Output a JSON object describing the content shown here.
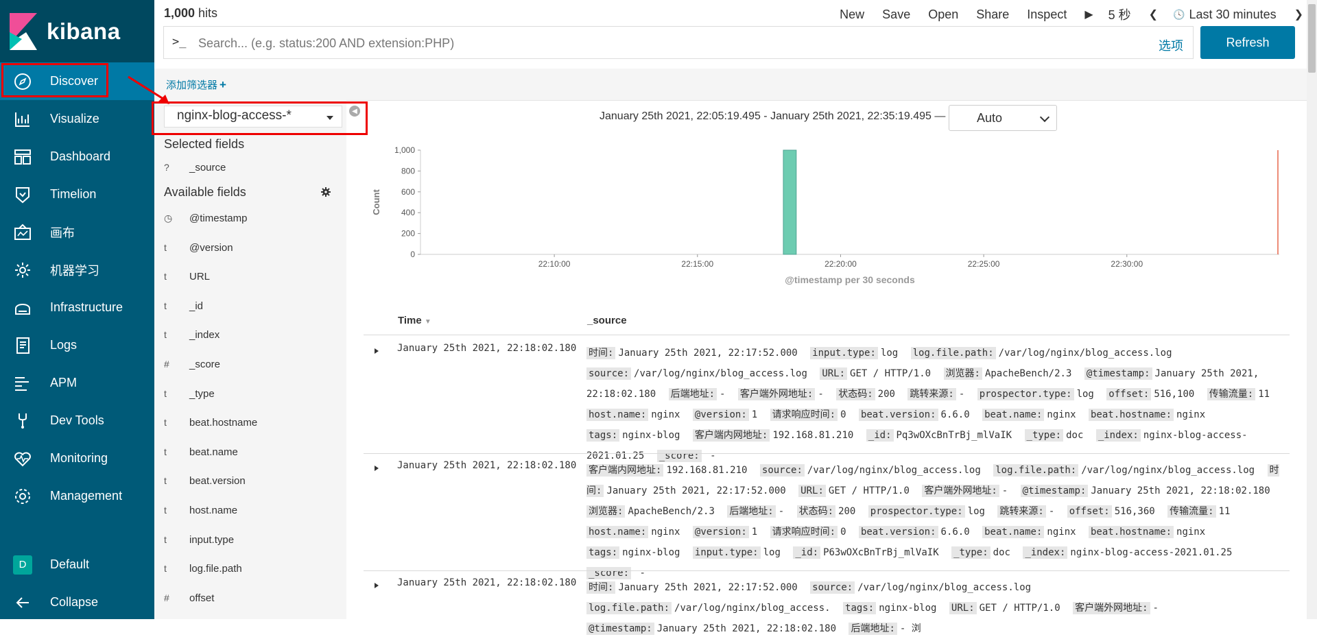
{
  "brand": {
    "name": "kibana"
  },
  "sidebar": {
    "items": [
      {
        "label": "Discover",
        "icon": "compass-icon"
      },
      {
        "label": "Visualize",
        "icon": "visualize-icon"
      },
      {
        "label": "Dashboard",
        "icon": "dashboard-icon"
      },
      {
        "label": "Timelion",
        "icon": "timelion-icon"
      },
      {
        "label": "画布",
        "icon": "canvas-icon"
      },
      {
        "label": "机器学习",
        "icon": "machine-learning-icon"
      },
      {
        "label": "Infrastructure",
        "icon": "infrastructure-icon"
      },
      {
        "label": "Logs",
        "icon": "logs-icon"
      },
      {
        "label": "APM",
        "icon": "apm-icon"
      },
      {
        "label": "Dev Tools",
        "icon": "wrench-icon"
      },
      {
        "label": "Monitoring",
        "icon": "heartbeat-icon"
      },
      {
        "label": "Management",
        "icon": "gear-icon"
      }
    ],
    "space": {
      "avatar": "D",
      "label": "Default"
    },
    "collapse": "Collapse"
  },
  "topbar": {
    "hits_count": "1,000",
    "hits_label": " hits",
    "menu": [
      "New",
      "Save",
      "Open",
      "Share",
      "Inspect"
    ],
    "play": "▶",
    "refresh_interval": "5 秒",
    "prev": "❮",
    "clock": "🕓",
    "time_range": "Last 30 minutes",
    "next": "❯"
  },
  "search": {
    "prompt": ">_",
    "placeholder": "Search... (e.g. status:200 AND extension:PHP)",
    "options": "选项",
    "refresh": "Refresh"
  },
  "filters": {
    "add_label": "添加筛选器",
    "add_plus": "+"
  },
  "fields": {
    "index_pattern": "nginx-blog-access-*",
    "selected_title": "Selected fields",
    "selected": [
      {
        "type": "?",
        "name": "_source"
      }
    ],
    "available_title": "Available fields",
    "available": [
      {
        "type": "◷",
        "name": "@timestamp"
      },
      {
        "type": "t",
        "name": "@version"
      },
      {
        "type": "t",
        "name": "URL"
      },
      {
        "type": "t",
        "name": "_id"
      },
      {
        "type": "t",
        "name": "_index"
      },
      {
        "type": "#",
        "name": "_score"
      },
      {
        "type": "t",
        "name": "_type"
      },
      {
        "type": "t",
        "name": "beat.hostname"
      },
      {
        "type": "t",
        "name": "beat.name"
      },
      {
        "type": "t",
        "name": "beat.version"
      },
      {
        "type": "t",
        "name": "host.name"
      },
      {
        "type": "t",
        "name": "input.type"
      },
      {
        "type": "t",
        "name": "log.file.path"
      },
      {
        "type": "#",
        "name": "offset"
      }
    ]
  },
  "histogram": {
    "range_text": "January 25th 2021, 22:05:19.495 - January 25th 2021, 22:35:19.495 —",
    "interval": "Auto"
  },
  "chart_data": {
    "type": "bar",
    "ylabel": "Count",
    "xlabel": "@timestamp per 30 seconds",
    "ylim": [
      0,
      1000
    ],
    "yticks": [
      "0",
      "200",
      "400",
      "600",
      "800",
      "1,000"
    ],
    "xticks": [
      "22:10:00",
      "22:15:00",
      "22:20:00",
      "22:25:00",
      "22:30:00"
    ],
    "series": [
      {
        "x": "22:18:00",
        "values": [
          1000
        ]
      }
    ],
    "bar_color": "#6dccb1"
  },
  "table": {
    "col_time": "Time",
    "col_source": "_source",
    "rows": [
      {
        "time": "January 25th 2021, 22:18:02.180",
        "pairs": [
          [
            "时间:",
            "January 25th 2021, 22:17:52.000"
          ],
          [
            "input.type:",
            "log"
          ],
          [
            "log.file.path:",
            "/var/log/nginx/blog_access.log"
          ],
          [
            "source:",
            "/var/log/nginx/blog_access.log"
          ],
          [
            "URL:",
            "GET / HTTP/1.0"
          ],
          [
            "浏览器:",
            "ApacheBench/2.3"
          ],
          [
            "@timestamp:",
            "January 25th 2021, 22:18:02.180"
          ],
          [
            "后端地址:",
            "-"
          ],
          [
            "客户端外网地址:",
            "-"
          ],
          [
            "状态码:",
            "200"
          ],
          [
            "跳转来源:",
            "-"
          ],
          [
            "prospector.type:",
            "log"
          ],
          [
            "offset:",
            "516,100"
          ],
          [
            "传输流量:",
            "11"
          ],
          [
            "host.name:",
            "nginx"
          ],
          [
            "@version:",
            "1"
          ],
          [
            "请求响应时间:",
            "0"
          ],
          [
            "beat.version:",
            "6.6.0"
          ],
          [
            "beat.name:",
            "nginx"
          ],
          [
            "beat.hostname:",
            "nginx"
          ],
          [
            "tags:",
            "nginx-blog"
          ],
          [
            "客户端内网地址:",
            "192.168.81.210"
          ],
          [
            "_id:",
            "Pq3wOXcBnTrBj_mlVaIK"
          ],
          [
            "_type:",
            "doc"
          ],
          [
            "_index:",
            "nginx-blog-access-2021.01.25"
          ],
          [
            "_score:",
            " -"
          ]
        ]
      },
      {
        "time": "January 25th 2021, 22:18:02.180",
        "pairs": [
          [
            "客户端内网地址:",
            "192.168.81.210"
          ],
          [
            "source:",
            "/var/log/nginx/blog_access.log"
          ],
          [
            "log.file.path:",
            "/var/log/nginx/blog_access.log"
          ],
          [
            "时间:",
            "January 25th 2021, 22:17:52.000"
          ],
          [
            "URL:",
            "GET / HTTP/1.0"
          ],
          [
            "客户端外网地址:",
            "-"
          ],
          [
            "@timestamp:",
            "January 25th 2021, 22:18:02.180"
          ],
          [
            "浏览器:",
            "ApacheBench/2.3"
          ],
          [
            "后端地址:",
            "-"
          ],
          [
            "状态码:",
            "200"
          ],
          [
            "prospector.type:",
            "log"
          ],
          [
            "跳转来源:",
            "-"
          ],
          [
            "offset:",
            "516,360"
          ],
          [
            "传输流量:",
            "11"
          ],
          [
            "host.name:",
            "nginx"
          ],
          [
            "@version:",
            "1"
          ],
          [
            "请求响应时间:",
            "0"
          ],
          [
            "beat.version:",
            "6.6.0"
          ],
          [
            "beat.name:",
            "nginx"
          ],
          [
            "beat.hostname:",
            "nginx"
          ],
          [
            "tags:",
            "nginx-blog"
          ],
          [
            "input.type:",
            "log"
          ],
          [
            "_id:",
            "P63wOXcBnTrBj_mlVaIK"
          ],
          [
            "_type:",
            "doc"
          ],
          [
            "_index:",
            "nginx-blog-access-2021.01.25"
          ],
          [
            "_score:",
            " -"
          ]
        ]
      },
      {
        "time": "January 25th 2021, 22:18:02.180",
        "pairs": [
          [
            "时间:",
            "January 25th 2021, 22:17:52.000"
          ],
          [
            "source:",
            "/var/log/nginx/blog_access.log"
          ],
          [
            "log.file.path:",
            "/var/log/nginx/blog_access."
          ],
          [
            "tags:",
            "nginx-blog"
          ],
          [
            "URL:",
            "GET / HTTP/1.0"
          ],
          [
            "客户端外网地址:",
            "-"
          ],
          [
            "@timestamp:",
            "January 25th 2021, 22:18:02.180"
          ],
          [
            "后端地址:",
            "- 浏"
          ]
        ]
      }
    ]
  },
  "colors": {
    "sidebar": "#005a78",
    "sidebar_active": "#0079a5",
    "accent": "#0079a5",
    "annotation": "#e00000"
  }
}
